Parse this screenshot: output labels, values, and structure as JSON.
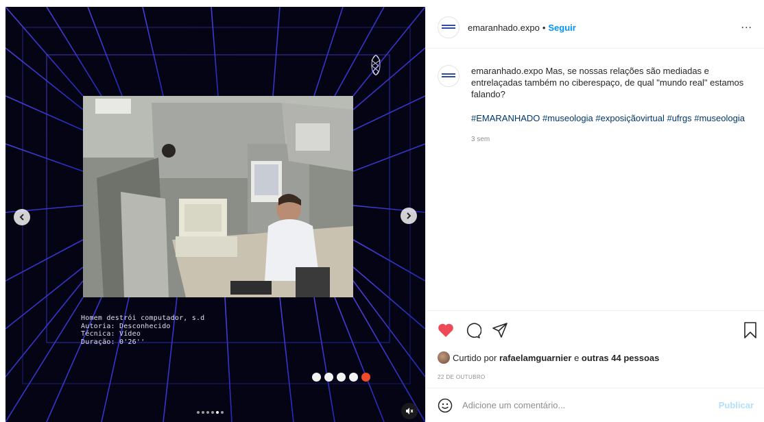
{
  "post": {
    "username": "emaranhado.expo",
    "separator": "•",
    "follow_label": "Seguir",
    "more_label": "...",
    "caption_user": "emaranhado.expo",
    "caption_text": "Mas, se nossas relações são mediadas e entrelaçadas também no ciberespaço, de qual \"mundo real\" estamos falando?",
    "hashtags": [
      "#EMARANHADO",
      "#museologia",
      "#exposiçãovirtual",
      "#ufrgs",
      "#museologia"
    ],
    "time_ago": "3 sem",
    "liked_prefix": "Curtido por",
    "liked_user": "rafaelamguarnier",
    "liked_and": "e",
    "liked_others": "outras 44 pessoas",
    "date": "22 DE OUTUBRO",
    "comment_placeholder": "Adicione um comentário...",
    "publish_label": "Publicar"
  },
  "media": {
    "caption_lines": [
      "Homem destrói computador, s.d",
      "Autoria: Desconhecido",
      "Técnica: Vídeo",
      "Duração: 0'26''"
    ],
    "slide_dots_total": 5,
    "slide_dots_active": 5,
    "carousel_total": 6,
    "carousel_active": 5
  },
  "icons": {
    "prev": "chevron-left-icon",
    "next": "chevron-right-icon",
    "mute": "speaker-muted-icon",
    "like": "heart-icon",
    "comment": "comment-bubble-icon",
    "share": "paper-plane-icon",
    "save": "bookmark-icon",
    "emoji": "smiley-icon"
  },
  "colors": {
    "like_red": "#ed4956",
    "link_blue": "#0095f6",
    "hashtag_blue": "#00376b",
    "active_dot": "#ef4a2c",
    "media_background": "#040414",
    "grid_lines": "#3f3ad8"
  }
}
